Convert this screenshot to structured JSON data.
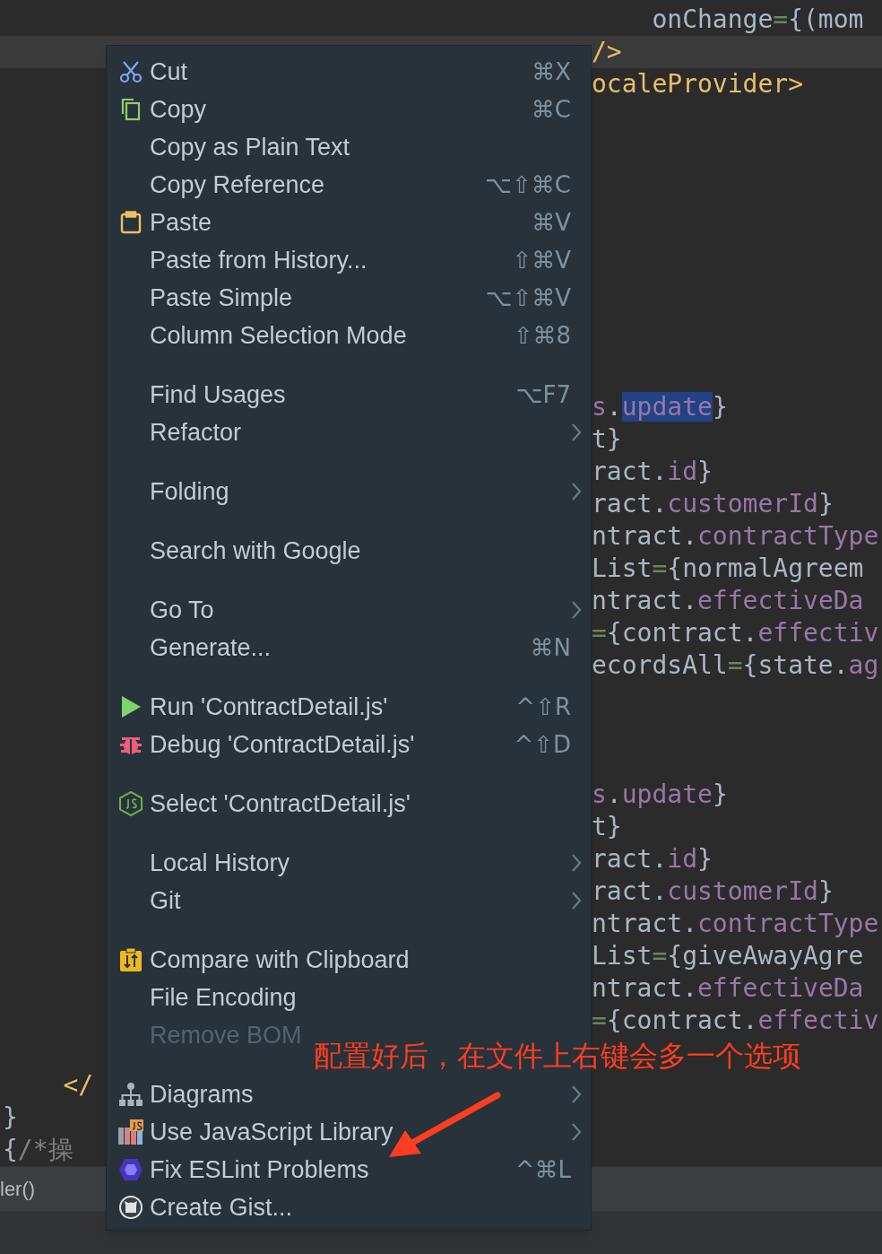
{
  "editor": {
    "lines": [
      {
        "current": false,
        "right": [
          {
            "kind": "plain",
            "text": "    onChange"
          },
          {
            "kind": "operator",
            "text": "="
          },
          {
            "kind": "plain",
            "text": "{(mom"
          }
        ]
      },
      {
        "current": true,
        "right": [
          {
            "kind": "tag",
            "text": "/>"
          }
        ]
      },
      {
        "current": false,
        "right": [
          {
            "kind": "tag",
            "text": "ocaleProvider>"
          }
        ]
      },
      {
        "current": false
      },
      {
        "current": false
      },
      {
        "current": false
      },
      {
        "current": false
      },
      {
        "current": false
      },
      {
        "current": false
      },
      {
        "current": false
      },
      {
        "current": false
      },
      {
        "current": false
      },
      {
        "current": false,
        "right": [
          {
            "kind": "property",
            "text": "s"
          },
          {
            "kind": "plain",
            "text": "."
          },
          {
            "kind": "selected",
            "text": "update"
          },
          {
            "kind": "plain",
            "text": "}"
          }
        ]
      },
      {
        "current": false,
        "right": [
          {
            "kind": "plain",
            "text": "t}"
          }
        ]
      },
      {
        "current": false,
        "right": [
          {
            "kind": "plain",
            "text": "ract."
          },
          {
            "kind": "property",
            "text": "id"
          },
          {
            "kind": "plain",
            "text": "}"
          }
        ]
      },
      {
        "current": false,
        "right": [
          {
            "kind": "plain",
            "text": "ract."
          },
          {
            "kind": "property",
            "text": "customerId"
          },
          {
            "kind": "plain",
            "text": "}"
          }
        ]
      },
      {
        "current": false,
        "right": [
          {
            "kind": "plain",
            "text": "ntract."
          },
          {
            "kind": "property",
            "text": "contractType"
          }
        ]
      },
      {
        "current": false,
        "right": [
          {
            "kind": "plain",
            "text": "List"
          },
          {
            "kind": "operator",
            "text": "="
          },
          {
            "kind": "plain",
            "text": "{normalAgreem"
          }
        ]
      },
      {
        "current": false,
        "right": [
          {
            "kind": "plain",
            "text": "ntract."
          },
          {
            "kind": "property",
            "text": "effectiveDa"
          }
        ]
      },
      {
        "current": false,
        "right": [
          {
            "kind": "operator",
            "text": "="
          },
          {
            "kind": "plain",
            "text": "{contract."
          },
          {
            "kind": "property",
            "text": "effectiv"
          }
        ]
      },
      {
        "current": false,
        "right": [
          {
            "kind": "plain",
            "text": "ecordsAll"
          },
          {
            "kind": "operator",
            "text": "="
          },
          {
            "kind": "plain",
            "text": "{state."
          },
          {
            "kind": "property",
            "text": "ag"
          }
        ]
      },
      {
        "current": false
      },
      {
        "current": false
      },
      {
        "current": false
      },
      {
        "current": false,
        "right": [
          {
            "kind": "property",
            "text": "s"
          },
          {
            "kind": "plain",
            "text": "."
          },
          {
            "kind": "property",
            "text": "update"
          },
          {
            "kind": "plain",
            "text": "}"
          }
        ]
      },
      {
        "current": false,
        "right": [
          {
            "kind": "plain",
            "text": "t}"
          }
        ]
      },
      {
        "current": false,
        "right": [
          {
            "kind": "plain",
            "text": "ract."
          },
          {
            "kind": "property",
            "text": "id"
          },
          {
            "kind": "plain",
            "text": "}"
          }
        ]
      },
      {
        "current": false,
        "right": [
          {
            "kind": "plain",
            "text": "ract."
          },
          {
            "kind": "property",
            "text": "customerId"
          },
          {
            "kind": "plain",
            "text": "}"
          }
        ]
      },
      {
        "current": false,
        "right": [
          {
            "kind": "plain",
            "text": "ntract."
          },
          {
            "kind": "property",
            "text": "contractType"
          }
        ]
      },
      {
        "current": false,
        "right": [
          {
            "kind": "plain",
            "text": "List"
          },
          {
            "kind": "operator",
            "text": "="
          },
          {
            "kind": "plain",
            "text": "{giveAwayAgre"
          }
        ]
      },
      {
        "current": false,
        "right": [
          {
            "kind": "plain",
            "text": "ntract."
          },
          {
            "kind": "property",
            "text": "effectiveDa"
          }
        ]
      },
      {
        "current": false,
        "right": [
          {
            "kind": "operator",
            "text": "="
          },
          {
            "kind": "plain",
            "text": "{contract."
          },
          {
            "kind": "property",
            "text": "effectiv"
          }
        ]
      },
      {
        "current": false
      },
      {
        "current": false,
        "left": [
          {
            "kind": "tag",
            "text": "    </"
          }
        ]
      },
      {
        "current": false,
        "left": [
          {
            "kind": "plain",
            "text": "}"
          }
        ]
      },
      {
        "current": false,
        "left": [
          {
            "kind": "plain",
            "text": "{"
          },
          {
            "kind": "comment",
            "text": "/*操"
          }
        ]
      }
    ]
  },
  "breadcrumb": "ler()",
  "context_menu": {
    "groups": [
      {
        "items": [
          {
            "kind": "cut",
            "label": "Cut",
            "shortcut": "⌘X",
            "submenu": false,
            "disabled": false
          },
          {
            "kind": "copy",
            "label": "Copy",
            "shortcut": "⌘C",
            "submenu": false,
            "disabled": false
          },
          {
            "kind": "plain",
            "label": "Copy as Plain Text",
            "submenu": false,
            "disabled": false
          },
          {
            "kind": "plain",
            "label": "Copy Reference",
            "shortcut": "⌥⇧⌘C",
            "submenu": false,
            "disabled": false
          },
          {
            "kind": "paste",
            "label": "Paste",
            "shortcut": "⌘V",
            "submenu": false,
            "disabled": false
          },
          {
            "kind": "plain",
            "label": "Paste from History...",
            "shortcut": "⇧⌘V",
            "submenu": false,
            "disabled": false
          },
          {
            "kind": "plain",
            "label": "Paste Simple",
            "shortcut": "⌥⇧⌘V",
            "submenu": false,
            "disabled": false
          },
          {
            "kind": "plain",
            "label": "Column Selection Mode",
            "shortcut": "⇧⌘8",
            "submenu": false,
            "disabled": false
          }
        ]
      },
      {
        "items": [
          {
            "kind": "plain",
            "label": "Find Usages",
            "shortcut": "⌥F7",
            "submenu": false,
            "disabled": false
          },
          {
            "kind": "plain",
            "label": "Refactor",
            "submenu": true,
            "disabled": false
          }
        ]
      },
      {
        "items": [
          {
            "kind": "plain",
            "label": "Folding",
            "submenu": true,
            "disabled": false
          }
        ]
      },
      {
        "items": [
          {
            "kind": "plain",
            "label": "Search with Google",
            "submenu": false,
            "disabled": false
          }
        ]
      },
      {
        "items": [
          {
            "kind": "plain",
            "label": "Go To",
            "submenu": true,
            "disabled": false
          },
          {
            "kind": "plain",
            "label": "Generate...",
            "shortcut": "⌘N",
            "submenu": false,
            "disabled": false
          }
        ]
      },
      {
        "items": [
          {
            "kind": "run",
            "label": "Run 'ContractDetail.js'",
            "shortcut": "^⇧R",
            "submenu": false,
            "disabled": false
          },
          {
            "kind": "debug",
            "label": "Debug 'ContractDetail.js'",
            "shortcut": "^⇧D",
            "submenu": false,
            "disabled": false
          }
        ]
      },
      {
        "items": [
          {
            "kind": "select",
            "label": "Select 'ContractDetail.js'",
            "submenu": false,
            "disabled": false
          }
        ]
      },
      {
        "items": [
          {
            "kind": "plain",
            "label": "Local History",
            "submenu": true,
            "disabled": false
          },
          {
            "kind": "plain",
            "label": "Git",
            "submenu": true,
            "disabled": false
          }
        ]
      },
      {
        "items": [
          {
            "kind": "compare",
            "label": "Compare with Clipboard",
            "submenu": false,
            "disabled": false
          },
          {
            "kind": "plain",
            "label": "File Encoding",
            "submenu": false,
            "disabled": false
          },
          {
            "kind": "plain",
            "label": "Remove BOM",
            "submenu": false,
            "disabled": true
          }
        ]
      },
      {
        "items": [
          {
            "kind": "diagrams",
            "label": "Diagrams",
            "submenu": true,
            "disabled": false
          },
          {
            "kind": "library",
            "label": "Use JavaScript Library",
            "submenu": true,
            "disabled": false
          },
          {
            "kind": "eslint",
            "label": "Fix ESLint Problems",
            "shortcut": "^⌘L",
            "submenu": false,
            "disabled": false
          },
          {
            "kind": "gist",
            "label": "Create Gist...",
            "submenu": false,
            "disabled": false
          }
        ]
      }
    ]
  },
  "annotation": {
    "text": "配置好后，在文件上右键会多一个选项"
  }
}
